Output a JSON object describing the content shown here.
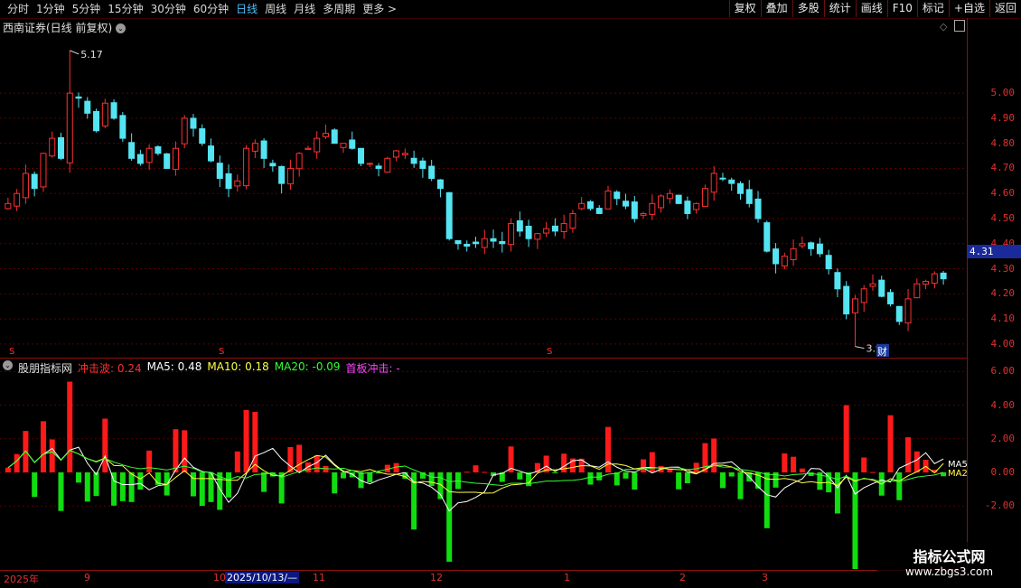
{
  "period_tabs": [
    "分时",
    "1分钟",
    "5分钟",
    "15分钟",
    "30分钟",
    "60分钟",
    "日线",
    "周线",
    "月线",
    "多周期",
    "更多 >"
  ],
  "active_tab": "日线",
  "tools": [
    "复权",
    "叠加",
    "多股",
    "统计",
    "画线",
    "F10",
    "标记",
    "+自选",
    "返回"
  ],
  "stock_title": "西南证券(日线 前复权)",
  "price_axis": [
    "5.00",
    "4.90",
    "4.80",
    "4.70",
    "4.60",
    "4.50",
    "4.40",
    "4.30",
    "4.20",
    "4.10",
    "4.00"
  ],
  "current_price": "4.31",
  "high_label": "5.17",
  "low_label": "3.99",
  "cai_badge": "财",
  "s_marker": "S",
  "indicator": {
    "name": "股朋指标网",
    "chongji": "冲击波: 0.24",
    "ma5": "MA5: 0.48",
    "ma10": "MA10: 0.18",
    "ma20": "MA20: -0.09",
    "shouban": "首板冲击: -",
    "ma5_tag": "MA5",
    "ma2_tag": "MA2"
  },
  "ind_axis": [
    "6.00",
    "4.00",
    "2.00",
    "0.00",
    "-2.00"
  ],
  "x_labels": [
    "2025年",
    "9",
    "10",
    "11",
    "12",
    "1",
    "2",
    "3"
  ],
  "x_selected": "2025/10/13/—",
  "watermark": {
    "line1": "指标公式网",
    "line2": "www.zbgs3.com"
  },
  "colors": {
    "up": "#ff3030",
    "down": "#54e4f2",
    "pos_bar": "#ff1a1a",
    "neg_bar": "#11dd11",
    "grid": "#5a0000"
  },
  "chart_data": {
    "type": "candlestick",
    "y_range": [
      3.96,
      5.22
    ],
    "ohlc_close_series": [
      4.56,
      4.6,
      4.68,
      4.62,
      4.76,
      4.82,
      4.74,
      5.0,
      4.98,
      4.92,
      4.85,
      4.96,
      4.9,
      4.82,
      4.74,
      4.72,
      4.78,
      4.76,
      4.7,
      4.78,
      4.9,
      4.86,
      4.8,
      4.73,
      4.66,
      4.62,
      4.65,
      4.78,
      4.8,
      4.74,
      4.71,
      4.64,
      4.7,
      4.76,
      4.78,
      4.82,
      4.84,
      4.8,
      4.8,
      4.78,
      4.72,
      4.72,
      4.7,
      4.74,
      4.77,
      4.76,
      4.72,
      4.7,
      4.66,
      4.62,
      4.42,
      4.4,
      4.39,
      4.4,
      4.42,
      4.41,
      4.4,
      4.48,
      4.45,
      4.42,
      4.44,
      4.46,
      4.45,
      4.48,
      4.52,
      4.56,
      4.54,
      4.52,
      4.61,
      4.58,
      4.55,
      4.5,
      4.52,
      4.56,
      4.59,
      4.6,
      4.56,
      4.52,
      4.56,
      4.62,
      4.68,
      4.66,
      4.64,
      4.6,
      4.56,
      4.5,
      4.37,
      4.32,
      4.35,
      4.38,
      4.4,
      4.38,
      4.36,
      4.3,
      4.22,
      4.12,
      4.18,
      4.22,
      4.24,
      4.19,
      4.16,
      4.09,
      4.18,
      4.24,
      4.25,
      4.28,
      4.26
    ]
  }
}
